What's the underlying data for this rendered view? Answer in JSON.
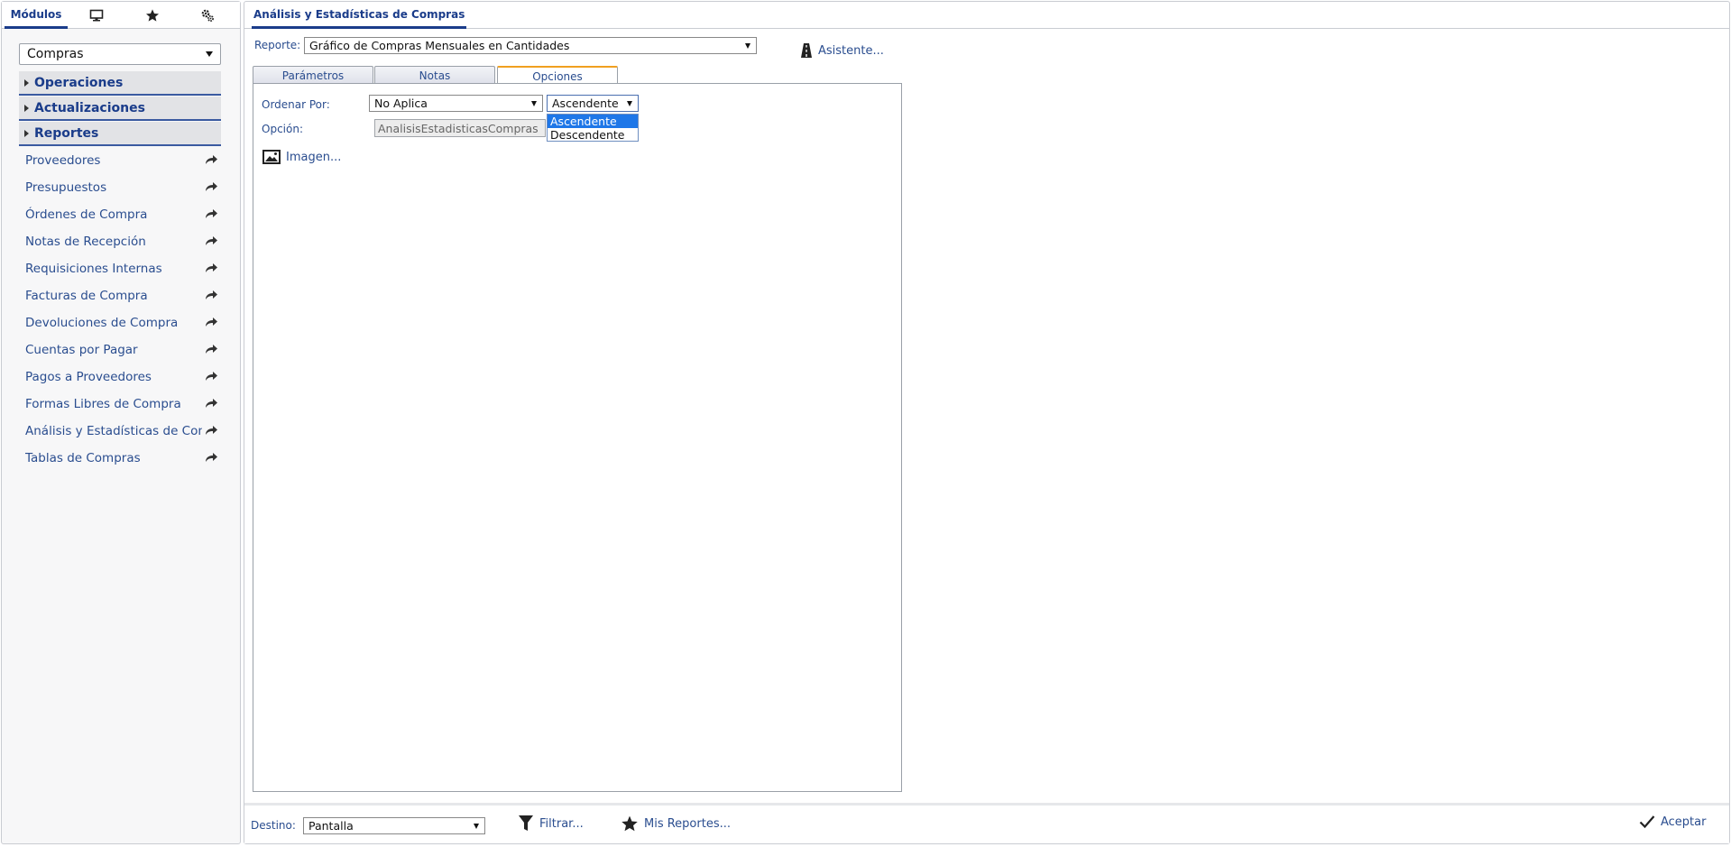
{
  "left_tabs": {
    "modulos": "Módulos",
    "screen_icon": "monitor-icon",
    "star_icon": "star-icon",
    "gear_icon": "gears-icon"
  },
  "module_select": {
    "value": "Compras"
  },
  "sections": [
    {
      "label": "Operaciones"
    },
    {
      "label": "Actualizaciones"
    },
    {
      "label": "Reportes"
    }
  ],
  "nav_items": [
    {
      "label": "Proveedores"
    },
    {
      "label": "Presupuestos"
    },
    {
      "label": "Órdenes de Compra"
    },
    {
      "label": "Notas de Recepción"
    },
    {
      "label": "Requisiciones Internas"
    },
    {
      "label": "Facturas de Compra"
    },
    {
      "label": "Devoluciones de Compra"
    },
    {
      "label": "Cuentas por Pagar"
    },
    {
      "label": "Pagos a Proveedores"
    },
    {
      "label": "Formas Libres de Compra"
    },
    {
      "label": "Análisis y Estadísticas de Compras"
    },
    {
      "label": "Tablas de Compras"
    }
  ],
  "main": {
    "title": "Análisis y Estadísticas de Compras",
    "reporte_label": "Reporte:",
    "reporte_value": "Gráfico de Compras Mensuales en Cantidades",
    "asistente": "Asistente...",
    "tabs": [
      {
        "label": "Parámetros"
      },
      {
        "label": "Notas"
      },
      {
        "label": "Opciones"
      }
    ],
    "ordenar_label": "Ordenar Por:",
    "ordenar_value": "No Aplica",
    "orden_value": "Ascendente",
    "orden_options": [
      {
        "label": "Ascendente"
      },
      {
        "label": "Descendente"
      }
    ],
    "opcion_label": "Opción:",
    "opcion_value": "AnalisisEstadisticasCompras",
    "imagen": "Imagen..."
  },
  "footer": {
    "destino_label": "Destino:",
    "destino_value": "Pantalla",
    "filtrar": "Filtrar...",
    "mis_reportes": "Mis Reportes...",
    "aceptar": "Aceptar"
  },
  "colors": {
    "accent": "#1a3c8a",
    "tab_active": "#f0a020",
    "selection": "#1e77e8"
  }
}
